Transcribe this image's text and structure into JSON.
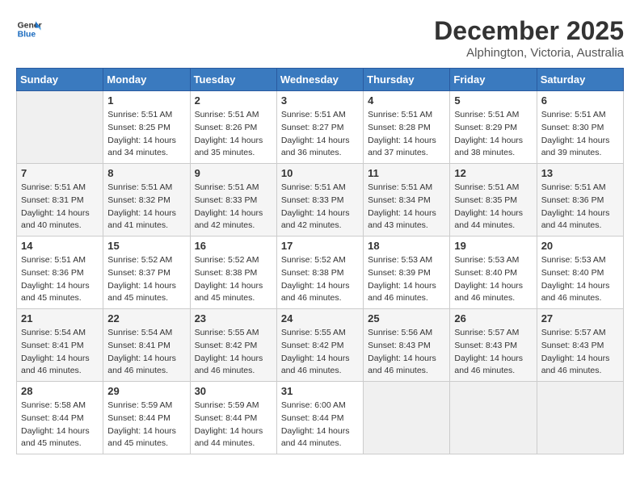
{
  "logo": {
    "line1": "General",
    "line2": "Blue"
  },
  "title": {
    "month_year": "December 2025",
    "location": "Alphington, Victoria, Australia"
  },
  "header": {
    "days": [
      "Sunday",
      "Monday",
      "Tuesday",
      "Wednesday",
      "Thursday",
      "Friday",
      "Saturday"
    ]
  },
  "weeks": [
    {
      "days": [
        {
          "num": "",
          "info": ""
        },
        {
          "num": "1",
          "info": "Sunrise: 5:51 AM\nSunset: 8:25 PM\nDaylight: 14 hours\nand 34 minutes."
        },
        {
          "num": "2",
          "info": "Sunrise: 5:51 AM\nSunset: 8:26 PM\nDaylight: 14 hours\nand 35 minutes."
        },
        {
          "num": "3",
          "info": "Sunrise: 5:51 AM\nSunset: 8:27 PM\nDaylight: 14 hours\nand 36 minutes."
        },
        {
          "num": "4",
          "info": "Sunrise: 5:51 AM\nSunset: 8:28 PM\nDaylight: 14 hours\nand 37 minutes."
        },
        {
          "num": "5",
          "info": "Sunrise: 5:51 AM\nSunset: 8:29 PM\nDaylight: 14 hours\nand 38 minutes."
        },
        {
          "num": "6",
          "info": "Sunrise: 5:51 AM\nSunset: 8:30 PM\nDaylight: 14 hours\nand 39 minutes."
        }
      ]
    },
    {
      "days": [
        {
          "num": "7",
          "info": "Sunrise: 5:51 AM\nSunset: 8:31 PM\nDaylight: 14 hours\nand 40 minutes."
        },
        {
          "num": "8",
          "info": "Sunrise: 5:51 AM\nSunset: 8:32 PM\nDaylight: 14 hours\nand 41 minutes."
        },
        {
          "num": "9",
          "info": "Sunrise: 5:51 AM\nSunset: 8:33 PM\nDaylight: 14 hours\nand 42 minutes."
        },
        {
          "num": "10",
          "info": "Sunrise: 5:51 AM\nSunset: 8:33 PM\nDaylight: 14 hours\nand 42 minutes."
        },
        {
          "num": "11",
          "info": "Sunrise: 5:51 AM\nSunset: 8:34 PM\nDaylight: 14 hours\nand 43 minutes."
        },
        {
          "num": "12",
          "info": "Sunrise: 5:51 AM\nSunset: 8:35 PM\nDaylight: 14 hours\nand 44 minutes."
        },
        {
          "num": "13",
          "info": "Sunrise: 5:51 AM\nSunset: 8:36 PM\nDaylight: 14 hours\nand 44 minutes."
        }
      ]
    },
    {
      "days": [
        {
          "num": "14",
          "info": "Sunrise: 5:51 AM\nSunset: 8:36 PM\nDaylight: 14 hours\nand 45 minutes."
        },
        {
          "num": "15",
          "info": "Sunrise: 5:52 AM\nSunset: 8:37 PM\nDaylight: 14 hours\nand 45 minutes."
        },
        {
          "num": "16",
          "info": "Sunrise: 5:52 AM\nSunset: 8:38 PM\nDaylight: 14 hours\nand 45 minutes."
        },
        {
          "num": "17",
          "info": "Sunrise: 5:52 AM\nSunset: 8:38 PM\nDaylight: 14 hours\nand 46 minutes."
        },
        {
          "num": "18",
          "info": "Sunrise: 5:53 AM\nSunset: 8:39 PM\nDaylight: 14 hours\nand 46 minutes."
        },
        {
          "num": "19",
          "info": "Sunrise: 5:53 AM\nSunset: 8:40 PM\nDaylight: 14 hours\nand 46 minutes."
        },
        {
          "num": "20",
          "info": "Sunrise: 5:53 AM\nSunset: 8:40 PM\nDaylight: 14 hours\nand 46 minutes."
        }
      ]
    },
    {
      "days": [
        {
          "num": "21",
          "info": "Sunrise: 5:54 AM\nSunset: 8:41 PM\nDaylight: 14 hours\nand 46 minutes."
        },
        {
          "num": "22",
          "info": "Sunrise: 5:54 AM\nSunset: 8:41 PM\nDaylight: 14 hours\nand 46 minutes."
        },
        {
          "num": "23",
          "info": "Sunrise: 5:55 AM\nSunset: 8:42 PM\nDaylight: 14 hours\nand 46 minutes."
        },
        {
          "num": "24",
          "info": "Sunrise: 5:55 AM\nSunset: 8:42 PM\nDaylight: 14 hours\nand 46 minutes."
        },
        {
          "num": "25",
          "info": "Sunrise: 5:56 AM\nSunset: 8:43 PM\nDaylight: 14 hours\nand 46 minutes."
        },
        {
          "num": "26",
          "info": "Sunrise: 5:57 AM\nSunset: 8:43 PM\nDaylight: 14 hours\nand 46 minutes."
        },
        {
          "num": "27",
          "info": "Sunrise: 5:57 AM\nSunset: 8:43 PM\nDaylight: 14 hours\nand 46 minutes."
        }
      ]
    },
    {
      "days": [
        {
          "num": "28",
          "info": "Sunrise: 5:58 AM\nSunset: 8:44 PM\nDaylight: 14 hours\nand 45 minutes."
        },
        {
          "num": "29",
          "info": "Sunrise: 5:59 AM\nSunset: 8:44 PM\nDaylight: 14 hours\nand 45 minutes."
        },
        {
          "num": "30",
          "info": "Sunrise: 5:59 AM\nSunset: 8:44 PM\nDaylight: 14 hours\nand 44 minutes."
        },
        {
          "num": "31",
          "info": "Sunrise: 6:00 AM\nSunset: 8:44 PM\nDaylight: 14 hours\nand 44 minutes."
        },
        {
          "num": "",
          "info": ""
        },
        {
          "num": "",
          "info": ""
        },
        {
          "num": "",
          "info": ""
        }
      ]
    }
  ]
}
